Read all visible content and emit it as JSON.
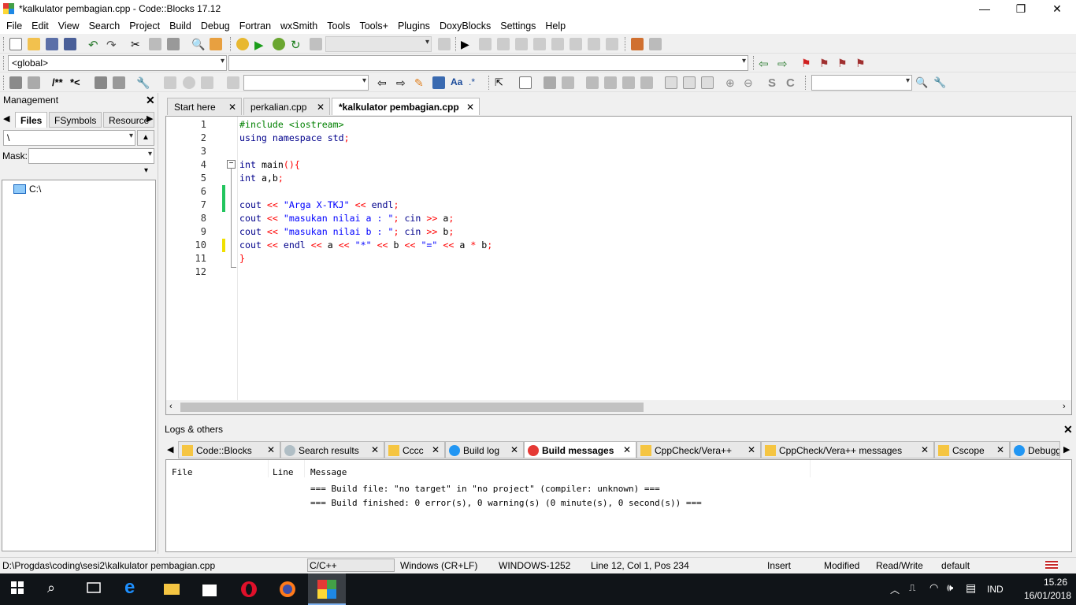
{
  "window": {
    "title": "*kalkulator pembagian.cpp - Code::Blocks 17.12",
    "minimize": "—",
    "maximize": "❐",
    "close": "✕"
  },
  "menu": [
    "File",
    "Edit",
    "View",
    "Search",
    "Project",
    "Build",
    "Debug",
    "Fortran",
    "wxSmith",
    "Tools",
    "Tools+",
    "Plugins",
    "DoxyBlocks",
    "Settings",
    "Help"
  ],
  "toolbar3": {
    "scope_combo": "<global>",
    "doxy_comment1": "/**",
    "doxy_comment2": "*<"
  },
  "management": {
    "title": "Management",
    "tabs": [
      "Files",
      "FSymbols",
      "Resource"
    ],
    "path_value": "\\",
    "mask_label": "Mask:",
    "mask_value": "",
    "tree_root": "C:\\"
  },
  "editor": {
    "tabs": [
      {
        "label": "Start here",
        "active": false
      },
      {
        "label": "perkalian.cpp",
        "active": false
      },
      {
        "label": "*kalkulator pembagian.cpp",
        "active": true
      }
    ],
    "lines": [
      {
        "n": "1",
        "text": "#include <iostream>",
        "kind": "pre"
      },
      {
        "n": "2",
        "text": "using namespace std;",
        "kind": "kw"
      },
      {
        "n": "3",
        "text": "",
        "kind": "plain"
      },
      {
        "n": "4",
        "text": "int main(){",
        "kind": "mixed"
      },
      {
        "n": "5",
        "text": "int a,b;",
        "kind": "mixed"
      },
      {
        "n": "6",
        "text": "",
        "kind": "plain"
      },
      {
        "n": "7",
        "text": "cout << \"Arga X-TKJ\" << endl;",
        "kind": "mixed"
      },
      {
        "n": "8",
        "text": "cout << \"masukan nilai a : \"; cin >> a;",
        "kind": "mixed"
      },
      {
        "n": "9",
        "text": "cout << \"masukan nilai b : \"; cin >> b;",
        "kind": "mixed"
      },
      {
        "n": "10",
        "text": "cout << endl << a << \"*\" << b << \"=\" << a * b;",
        "kind": "mixed"
      },
      {
        "n": "11",
        "text": "}",
        "kind": "mixed"
      },
      {
        "n": "12",
        "text": "",
        "kind": "plain"
      }
    ]
  },
  "logs": {
    "title": "Logs & others",
    "tabs": [
      "Code::Blocks",
      "Search results",
      "Cccc",
      "Build log",
      "Build messages",
      "CppCheck/Vera++",
      "CppCheck/Vera++ messages",
      "Cscope",
      "Debugge"
    ],
    "active_tab": "Build messages",
    "columns": [
      "File",
      "Line",
      "Message"
    ],
    "messages": [
      "=== Build file: \"no target\" in \"no project\" (compiler: unknown) ===",
      "=== Build finished: 0 error(s), 0 warning(s) (0 minute(s), 0 second(s)) ==="
    ]
  },
  "status": {
    "path": "D:\\Progdas\\coding\\sesi2\\kalkulator pembagian.cpp",
    "language": "C/C++",
    "eol": "Windows (CR+LF)",
    "encoding": "WINDOWS-1252",
    "position": "Line 12, Col 1, Pos 234",
    "insert": "Insert",
    "modified": "Modified",
    "rw": "Read/Write",
    "profile": "default"
  },
  "taskbar": {
    "time": "15.26",
    "date": "16/01/2018",
    "lang": "IND"
  },
  "colors": {
    "keyword": "#00008b",
    "preprocessor": "#008000",
    "string": "#0000ff",
    "operator": "#ff0000",
    "plain": "#000000",
    "changed_saved": "#00cc44",
    "changed_unsaved": "#f0e000"
  }
}
